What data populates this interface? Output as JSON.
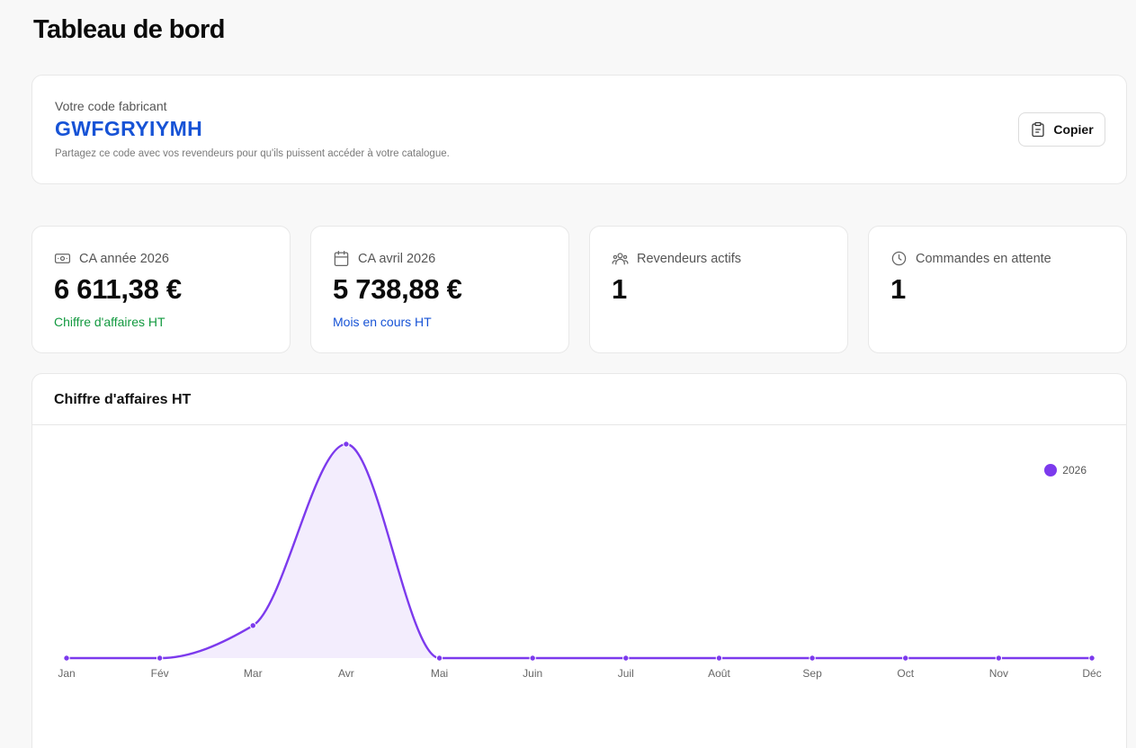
{
  "page": {
    "title": "Tableau de bord"
  },
  "code_card": {
    "label": "Votre code fabricant",
    "code": "GWFGRYIYMH",
    "help": "Partagez ce code avec vos revendeurs pour qu'ils puissent accéder à votre catalogue.",
    "copy_label": "Copier",
    "copy_icon": "clipboard-icon"
  },
  "stats": [
    {
      "label": "CA année 2026",
      "value": "6 611,38 €",
      "sub": "Chiffre d'affaires HT",
      "icon": "banknote-icon"
    },
    {
      "label": "CA avril 2026",
      "value": "5 738,88 €",
      "sub": "Mois en cours HT",
      "icon": "calendar-icon"
    },
    {
      "label": "Revendeurs actifs",
      "value": "1",
      "sub": "",
      "icon": "users-icon"
    },
    {
      "label": "Commandes en attente",
      "value": "1",
      "sub": "",
      "icon": "clock-icon"
    }
  ],
  "colors": {
    "accent": "#7c3aed",
    "brand_blue": "#1753d6",
    "success_green": "#12993f"
  },
  "chart_data": {
    "type": "area",
    "title": "Chiffre d'affaires HT",
    "categories": [
      "Jan",
      "Fév",
      "Mar",
      "Avr",
      "Mai",
      "Juin",
      "Juil",
      "Août",
      "Sep",
      "Oct",
      "Nov",
      "Déc"
    ],
    "series": [
      {
        "name": "2026",
        "color": "#7c3aed",
        "values": [
          0,
          0,
          872.5,
          5738.88,
          0,
          0,
          0,
          0,
          0,
          0,
          0,
          0
        ]
      }
    ],
    "ylim": [
      0,
      5738.88
    ],
    "grid": false,
    "legend": "top-right",
    "smooth": true
  }
}
